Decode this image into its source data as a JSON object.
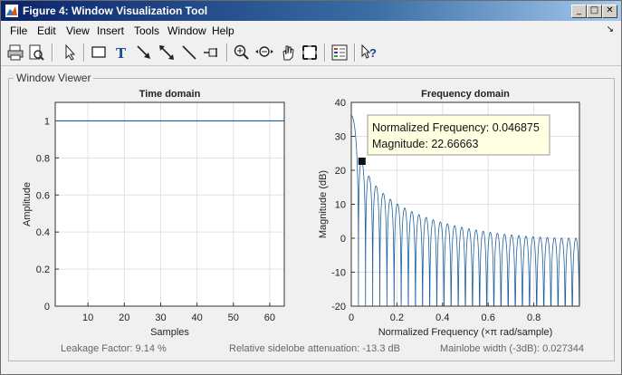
{
  "window": {
    "title": "Figure 4: Window Visualization Tool",
    "controls": {
      "minimize": "_",
      "maximize": "□",
      "close": "✕"
    }
  },
  "menubar": {
    "items": [
      "File",
      "Edit",
      "View",
      "Insert",
      "Tools",
      "Window",
      "Help"
    ],
    "dock_arrow": "↘"
  },
  "toolbar": {
    "buttons": [
      "print-icon",
      "print-preview-icon",
      "select-arrow-icon",
      "rectangle-icon",
      "text-icon",
      "arrow-icon",
      "double-arrow-icon",
      "line-icon",
      "pin-icon",
      "zoom-in-icon",
      "zoom-out-icon",
      "pan-icon",
      "zoom-fit-icon",
      "legend-icon",
      "whats-this-icon"
    ]
  },
  "panel": {
    "title": "Window Viewer"
  },
  "footer": {
    "leakage": "Leakage Factor: 9.14 %",
    "sidelobe": "Relative sidelobe attenuation: -13.3 dB",
    "mainlobe": "Mainlobe width (-3dB): 0.027344"
  },
  "datatip": {
    "line1": "Normalized Frequency: 0.046875",
    "line2": "Magnitude: 22.66663",
    "x": 0.046875,
    "y": 22.66663
  },
  "chart_data": [
    {
      "type": "line",
      "title": "Time domain",
      "xlabel": "Samples",
      "ylabel": "Amplitude",
      "xlim": [
        1,
        64
      ],
      "ylim": [
        0,
        1.1
      ],
      "xticks": [
        10,
        20,
        30,
        40,
        50,
        60
      ],
      "yticks": [
        0,
        0.2,
        0.4,
        0.6,
        0.8,
        1
      ],
      "ytick_labels": [
        "0",
        "0.2",
        "0.4",
        "0.6",
        "0.8",
        "1"
      ],
      "grid": true,
      "series": [
        {
          "x": [
            1,
            64
          ],
          "y": [
            1,
            1
          ],
          "color": "#1f5f9e"
        }
      ]
    },
    {
      "type": "line",
      "title": "Frequency domain",
      "xlabel": "Normalized Frequency",
      "xlabel_unit": "(×π rad/sample)",
      "ylabel": "Magnitude (dB)",
      "xlim": [
        0,
        1
      ],
      "ylim": [
        -20,
        40
      ],
      "xticks": [
        0,
        0.2,
        0.4,
        0.6,
        0.8
      ],
      "xtick_labels": [
        "0",
        "0.2",
        "0.4",
        "0.6",
        "0.8"
      ],
      "yticks": [
        -20,
        -10,
        0,
        10,
        20,
        30,
        40
      ],
      "grid": true,
      "series": [
        {
          "description_source": "rectangular window, N=64 DTFT magnitude",
          "window_length": 64,
          "peak_db": 36.1,
          "color": "#1f5f9e"
        }
      ]
    }
  ]
}
